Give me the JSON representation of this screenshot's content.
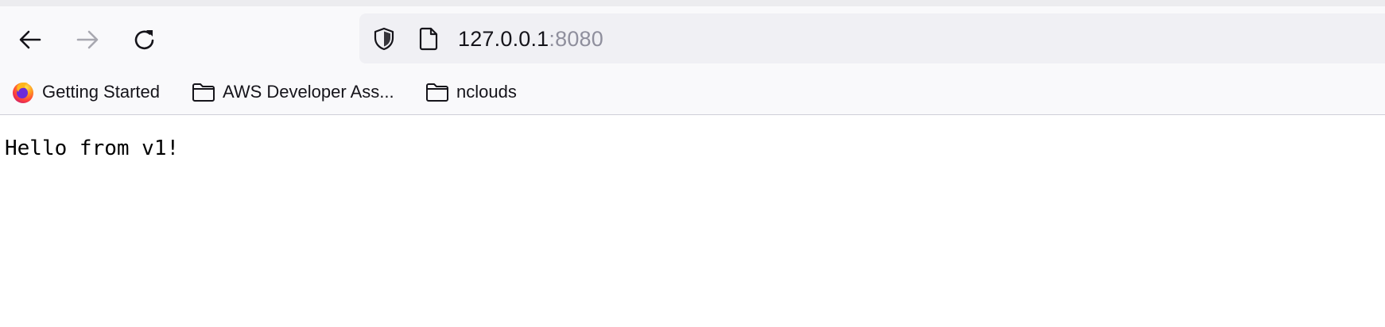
{
  "browser": {
    "nav": {
      "back_icon": "arrow-left-icon",
      "forward_icon": "arrow-right-icon",
      "reload_icon": "reload-icon"
    },
    "urlbar": {
      "security_icon": "shield-icon",
      "page_icon": "document-icon",
      "host": "127.0.0.1",
      "port": ":8080"
    },
    "bookmarks": [
      {
        "label": "Getting Started",
        "icon": "firefox-logo-icon"
      },
      {
        "label": "AWS Developer Ass...",
        "icon": "folder-icon"
      },
      {
        "label": "nclouds",
        "icon": "folder-icon"
      }
    ]
  },
  "page": {
    "body_text": "Hello from v1!"
  },
  "colors": {
    "toolbar_bg": "#f9f9fb",
    "urlbar_bg": "#f0f0f4",
    "text": "#15141a",
    "muted": "#8f8f9d"
  }
}
